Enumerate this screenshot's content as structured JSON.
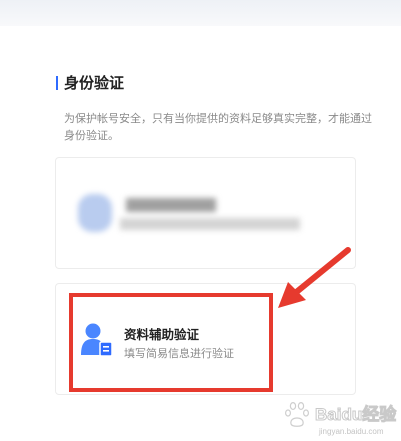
{
  "page": {
    "title": "身份验证",
    "description": "为保护帐号安全，只有当你提供的资料足够真实完整，才能通过身份验证。"
  },
  "options": [
    {
      "title": "",
      "subtitle": "",
      "icon": "user-blurred-icon",
      "blurred": true
    },
    {
      "title": "资料辅助验证",
      "subtitle": "填写简易信息进行验证",
      "icon": "user-card-icon",
      "highlighted": true
    }
  ],
  "annotation": {
    "arrow_color": "#e63a2e",
    "frame_color": "#e63a2e"
  },
  "watermark": {
    "brand": "Baidu经验",
    "url": "jingyan.baidu.com"
  },
  "colors": {
    "accent": "#2f6bff",
    "icon_blue": "#4a86ff",
    "annotation_red": "#e63a2e"
  }
}
